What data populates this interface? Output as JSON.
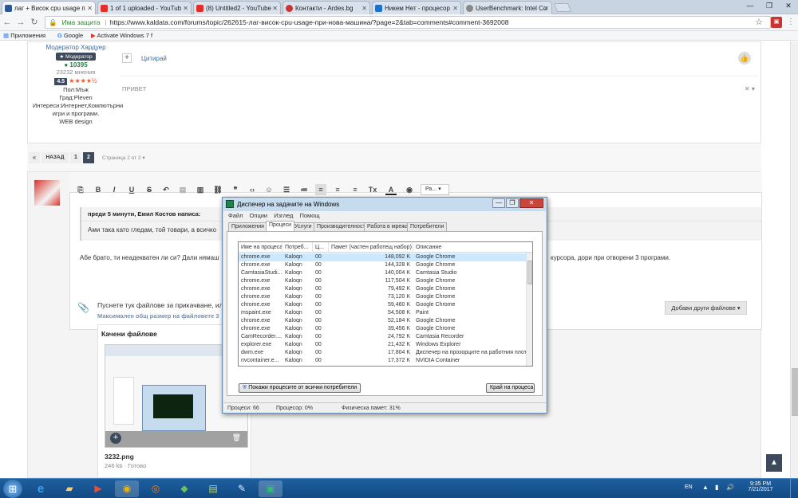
{
  "browser": {
    "tabs": [
      {
        "label": "лаг + Висок cpu usage п",
        "color": "#2b5797"
      },
      {
        "label": "1 of 1 uploaded - YouTub",
        "color": "#e52d27"
      },
      {
        "label": "(8) Untitled2 - YouTube",
        "color": "#e52d27"
      },
      {
        "label": "Контакти - Ardes.bg",
        "color": "#c33"
      },
      {
        "label": "Никем Нет - процесор",
        "color": "#1a73c8"
      },
      {
        "label": "UserBenchmark: Intel Co",
        "color": "#888"
      }
    ],
    "address": {
      "security": "Има защита",
      "url": "https://www.kaldata.com/forums/topic/262615-лаг-висок-cpu-usage-при-нова-машина/?page=2&tab=comments#comment-3692008"
    },
    "bookmarks": [
      "Приложения",
      "Google",
      "Activate Windows 7 f"
    ],
    "window_controls": [
      "—",
      "❐",
      "✕"
    ]
  },
  "forum": {
    "user": {
      "role": "Модератор Хардуер",
      "badge": "Модератор",
      "points": "10395",
      "opinions": "23232 мнения",
      "rating": "4.5",
      "stars": "★★★★½",
      "gender": "Пол:Мъж",
      "city": "Град:Pleven",
      "interests": "Интереси:Интернет,Компютърни игри и програми.",
      "interests2": "WEB design"
    },
    "quote_button": "Цитирай",
    "plus": "+",
    "post_text": "ПРИВЕТ",
    "pagination": {
      "prev": "«",
      "back": "НАЗАД",
      "p1": "1",
      "p2": "2",
      "pages": "Страница 2 от 2 ▾"
    },
    "editor": {
      "quote_header": "преди 5 минути, Емил Костов написа:",
      "quote_text": "Ами така като гледам, той товари, а всичко",
      "body_text": "Абе брато, ти неадекватен ли си? Дали нямаш",
      "body_text2": "курсора, дори при отворени 3 програми.",
      "font_menu": "Ра...",
      "upload_text": "Пуснете тук файлове за прикачване, или",
      "max_size": "Максимален общ размер на файловете 3",
      "add_files": "Добави други файлове ▾",
      "uploaded_title": "Качени файлове",
      "file_name": "3232.png",
      "file_meta": "246 kb · Готово"
    }
  },
  "taskmgr": {
    "title": "Диспечер на задачите на Windows",
    "controls": [
      "—",
      "❐",
      "✕"
    ],
    "menu": [
      "Файл",
      "Опции",
      "Изглед",
      "Помощ"
    ],
    "tabs": [
      "Приложения",
      "Процеси",
      "Услуги",
      "Производителност",
      "Работа в мрежа",
      "Потребители"
    ],
    "columns": [
      "Име на процеса",
      "Потреб...",
      "Ц...",
      "Памет (частен работещ набор)",
      "Описание"
    ],
    "rows": [
      [
        "chrome.exe",
        "Kaloqn",
        "00",
        "148,092 K",
        "Google Chrome"
      ],
      [
        "chrome.exe",
        "Kaloqn",
        "00",
        "144,328 K",
        "Google Chrome"
      ],
      [
        "CamtasiaStudi...",
        "Kaloqn",
        "00",
        "140,004 K",
        "Camtasia Studio"
      ],
      [
        "chrome.exe",
        "Kaloqn",
        "00",
        "117,504 K",
        "Google Chrome"
      ],
      [
        "chrome.exe",
        "Kaloqn",
        "00",
        "79,492 K",
        "Google Chrome"
      ],
      [
        "chrome.exe",
        "Kaloqn",
        "00",
        "73,120 K",
        "Google Chrome"
      ],
      [
        "chrome.exe",
        "Kaloqn",
        "00",
        "59,460 K",
        "Google Chrome"
      ],
      [
        "mspaint.exe",
        "Kaloqn",
        "00",
        "54,508 K",
        "Paint"
      ],
      [
        "chrome.exe",
        "Kaloqn",
        "00",
        "52,184 K",
        "Google Chrome"
      ],
      [
        "chrome.exe",
        "Kaloqn",
        "00",
        "39,456 K",
        "Google Chrome"
      ],
      [
        "CamRecorder....",
        "Kaloqn",
        "00",
        "24,792 K",
        "Camtasia Recorder"
      ],
      [
        "explorer.exe",
        "Kaloqn",
        "00",
        "21,432 K",
        "Windows Explorer"
      ],
      [
        "dwm.exe",
        "Kaloqn",
        "00",
        "17,804 K",
        "Диспечер на прозорците на работния плот"
      ],
      [
        "nvcontainer.e...",
        "Kaloqn",
        "00",
        "17,372 K",
        "NVIDIA Container"
      ]
    ],
    "show_all_button": "Покажи процесите от всички потребители",
    "end_process_button": "Край на процеса",
    "status": {
      "processes": "Процеси: 66",
      "cpu": "Процесор: 0%",
      "memory": "Физическа памет: 31%"
    }
  },
  "taskbar": {
    "lang": "EN",
    "time": "9:35 PM",
    "date": "7/21/2017",
    "start_glyph": "⊞"
  }
}
